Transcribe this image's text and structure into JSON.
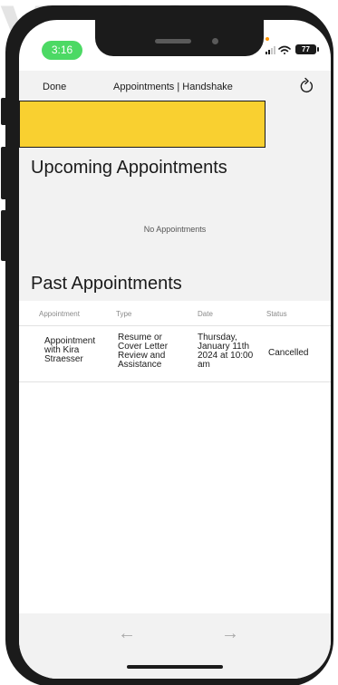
{
  "status_bar": {
    "time": "3:16",
    "battery": "77",
    "signal_icon": "cellular-signal-icon",
    "wifi_icon": "wifi-icon"
  },
  "nav": {
    "done_label": "Done",
    "title": "Appointments | Handshake",
    "refresh_icon": "refresh-icon"
  },
  "upcoming": {
    "heading": "Upcoming Appointments",
    "empty_text": "No Appointments"
  },
  "past": {
    "heading": "Past Appointments",
    "columns": [
      "Appointment",
      "Type",
      "Date",
      "Status"
    ],
    "rows": [
      {
        "appointment": "Appointment with Kira Straesser",
        "type": "Resume or Cover Letter Review and Assistance",
        "date": "Thursday, January 11th 2024 at 10:00 am",
        "status": "Cancelled"
      }
    ]
  },
  "toolbar": {
    "back_icon": "back-arrow-icon",
    "forward_icon": "forward-arrow-icon"
  },
  "colors": {
    "banner": "#f9d030",
    "time_pill": "#4cd964",
    "frame": "#1b1b1b"
  }
}
